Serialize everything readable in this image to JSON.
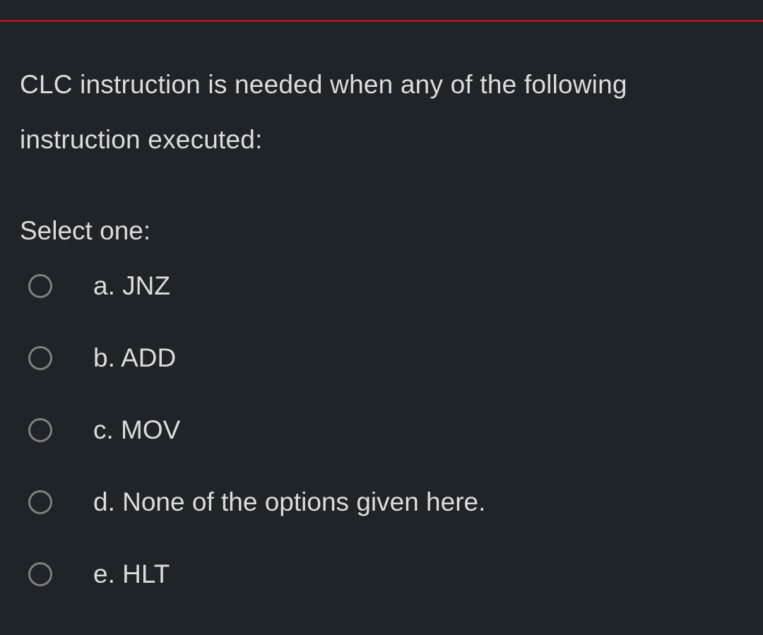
{
  "question": {
    "text": "CLC instruction is needed when any of the following instruction executed:",
    "select_label": "Select one:",
    "options": [
      {
        "key": "a",
        "label": "a. JNZ"
      },
      {
        "key": "b",
        "label": "b. ADD"
      },
      {
        "key": "c",
        "label": "c. MOV"
      },
      {
        "key": "d",
        "label": "d. None of the options given here."
      },
      {
        "key": "e",
        "label": "e. HLT"
      }
    ]
  },
  "colors": {
    "background": "#1f2428",
    "accent": "#b01820",
    "text": "#dcdcdc",
    "radio_border": "#808080"
  }
}
